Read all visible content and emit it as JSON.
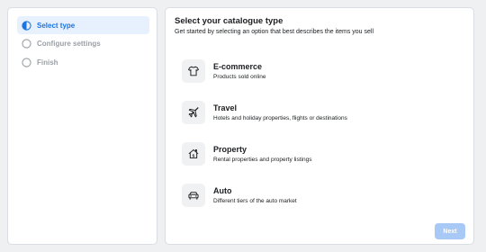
{
  "steps": [
    {
      "label": "Select type",
      "state": "active"
    },
    {
      "label": "Configure settings",
      "state": "inactive"
    },
    {
      "label": "Finish",
      "state": "inactive"
    }
  ],
  "main": {
    "title": "Select your catalogue type",
    "subtitle": "Get started by selecting an option that best describes the items you sell"
  },
  "options": [
    {
      "title": "E-commerce",
      "description": "Products sold online",
      "icon": "tshirt-icon"
    },
    {
      "title": "Travel",
      "description": "Hotels and holiday properties, flights or destinations",
      "icon": "airplane-icon"
    },
    {
      "title": "Property",
      "description": "Rental properties and property listings",
      "icon": "house-icon"
    },
    {
      "title": "Auto",
      "description": "Different tiers of the auto market",
      "icon": "car-icon"
    }
  ],
  "footer": {
    "next_label": "Next",
    "next_enabled": false
  },
  "colors": {
    "accent": "#1b74e4",
    "active_step_bg": "#e7f0fd",
    "disabled_button": "#a8c8f5",
    "background": "#eef0f2"
  }
}
